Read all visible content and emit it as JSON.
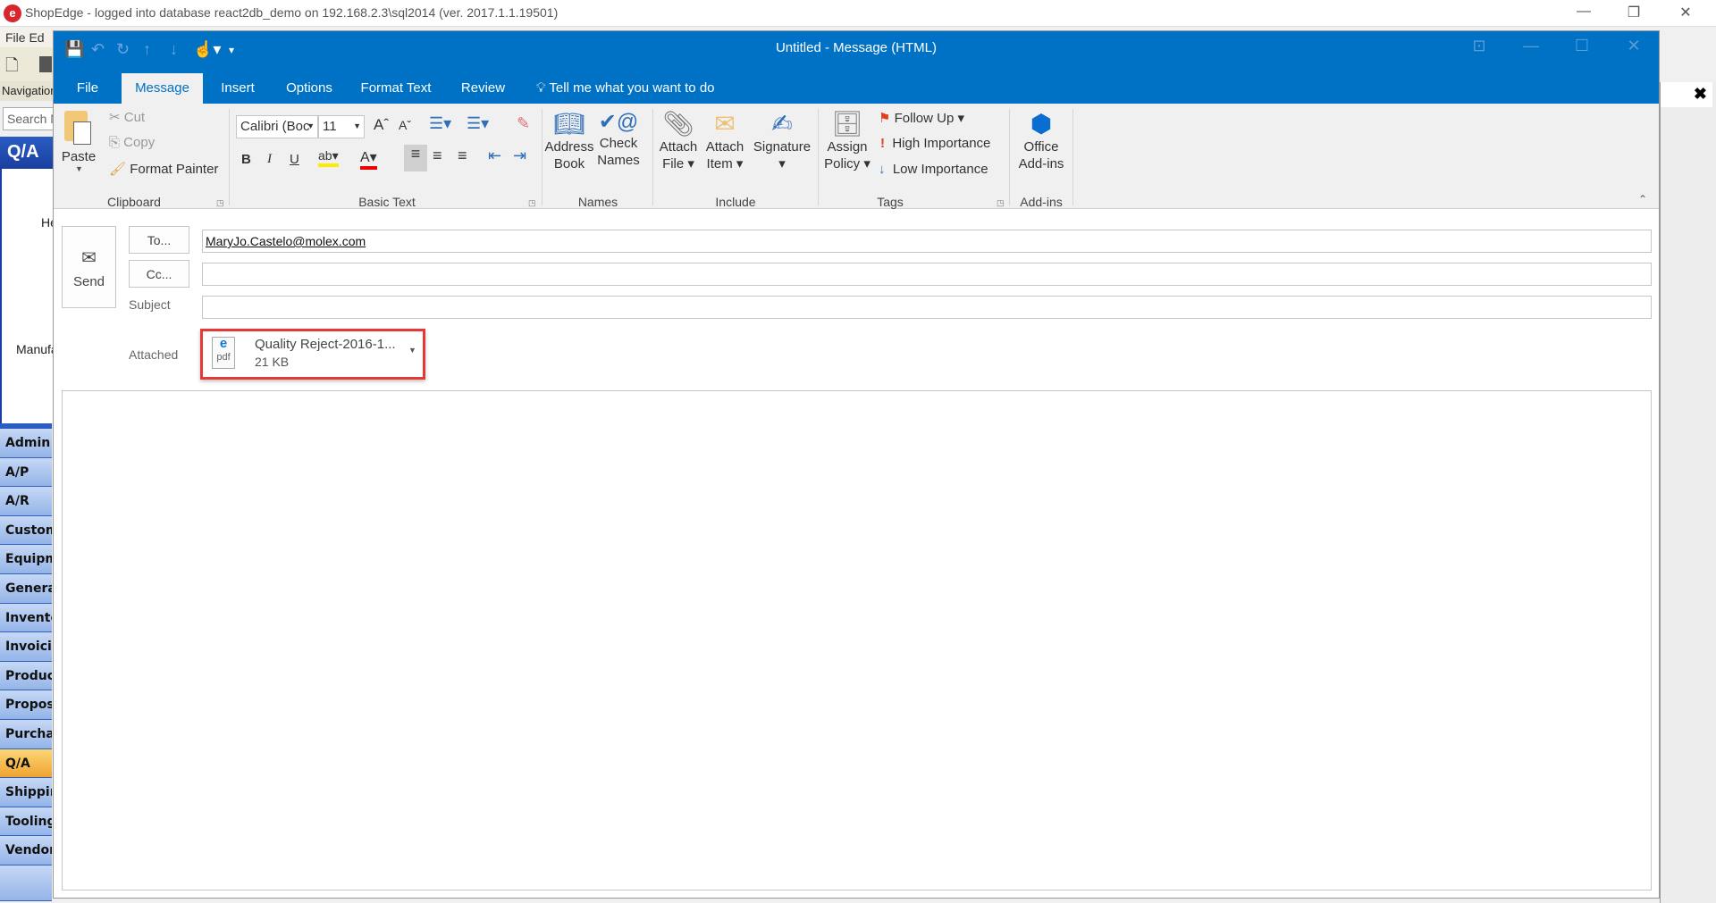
{
  "app": {
    "title": "ShopEdge -  logged into database react2db_demo on 192.168.2.3\\sql2014 (ver. 2017.1.1.19501)",
    "menu": "File Ed",
    "nav_header": "Navigation",
    "search_placeholder": "Search N",
    "section_header": "Q/A",
    "fragment_1": "He",
    "fragment_2": "Manufa",
    "nav_items": [
      {
        "label": "Admin"
      },
      {
        "label": "A/P"
      },
      {
        "label": "A/R"
      },
      {
        "label": "Custom"
      },
      {
        "label": "Equipm"
      },
      {
        "label": "Genera"
      },
      {
        "label": "Invento"
      },
      {
        "label": "Invoicin"
      },
      {
        "label": "Product"
      },
      {
        "label": "Propos"
      },
      {
        "label": "Purchas"
      },
      {
        "label": "Q/A",
        "active": true
      },
      {
        "label": "Shippin"
      },
      {
        "label": "Tooling"
      },
      {
        "label": "Vendor"
      }
    ]
  },
  "outlook": {
    "title": "Untitled  -  Message (HTML)",
    "tabs": [
      "File",
      "Message",
      "Insert",
      "Options",
      "Format Text",
      "Review"
    ],
    "tell_me": "Tell me what you want to do",
    "clipboard": {
      "paste": "Paste",
      "cut": "Cut",
      "copy": "Copy",
      "format_painter": "Format Painter",
      "label": "Clipboard"
    },
    "basic_text": {
      "font": "Calibri (Boc",
      "size": "11",
      "label": "Basic Text",
      "bold": "B",
      "italic": "I",
      "underline": "U"
    },
    "names": {
      "address_book": [
        "Address",
        "Book"
      ],
      "check_names": [
        "Check",
        "Names"
      ],
      "label": "Names"
    },
    "include": {
      "attach_file": [
        "Attach",
        "File"
      ],
      "attach_item": [
        "Attach",
        "Item"
      ],
      "signature": "Signature",
      "label": "Include"
    },
    "tags": {
      "assign_policy": [
        "Assign",
        "Policy"
      ],
      "follow_up": "Follow Up",
      "high": "High Importance",
      "low": "Low Importance",
      "label": "Tags"
    },
    "addins": {
      "office": [
        "Office",
        "Add-ins"
      ],
      "label": "Add-ins"
    },
    "compose": {
      "send": "Send",
      "to_button": "To...",
      "cc_button": "Cc...",
      "subject_label": "Subject",
      "attached_label": "Attached",
      "to_value": "MaryJo.Castelo@molex.com",
      "cc_value": "",
      "subject_value": "",
      "attachment": {
        "name": "Quality Reject-2016-1...",
        "size": "21 KB",
        "type": "pdf"
      }
    },
    "colors": {
      "accent": "#0072c6",
      "highlight_box": "#e53935"
    }
  }
}
